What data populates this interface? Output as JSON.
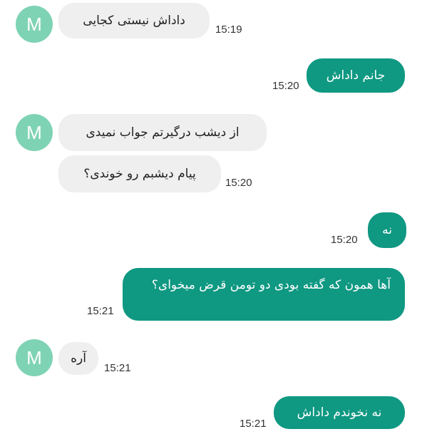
{
  "contact": {
    "avatar_letter": "M"
  },
  "messages": [
    {
      "direction": "incoming",
      "text": "داداش نیستی کجایی",
      "time": "15:19"
    },
    {
      "direction": "outgoing",
      "text": "جانم داداش",
      "time": "15:20"
    },
    {
      "direction": "incoming",
      "text": "از دیشب درگیرتم جواب نمیدی",
      "time": ""
    },
    {
      "direction": "incoming",
      "text": "پیام دیشبم رو خوندی؟",
      "time": "15:20"
    },
    {
      "direction": "outgoing",
      "text": "نه",
      "time": "15:20"
    },
    {
      "direction": "outgoing",
      "text": "آها همون که گفته بودی دو تومن قرض میخوای؟",
      "time": "15:21"
    },
    {
      "direction": "incoming",
      "text": "آره",
      "time": "15:21"
    },
    {
      "direction": "outgoing",
      "text": "نه نخوندم داداش",
      "time": "15:21"
    }
  ],
  "colors": {
    "incoming_bubble": "#efefef",
    "outgoing_bubble": "#0f9882",
    "avatar": "#7fd3b5"
  }
}
